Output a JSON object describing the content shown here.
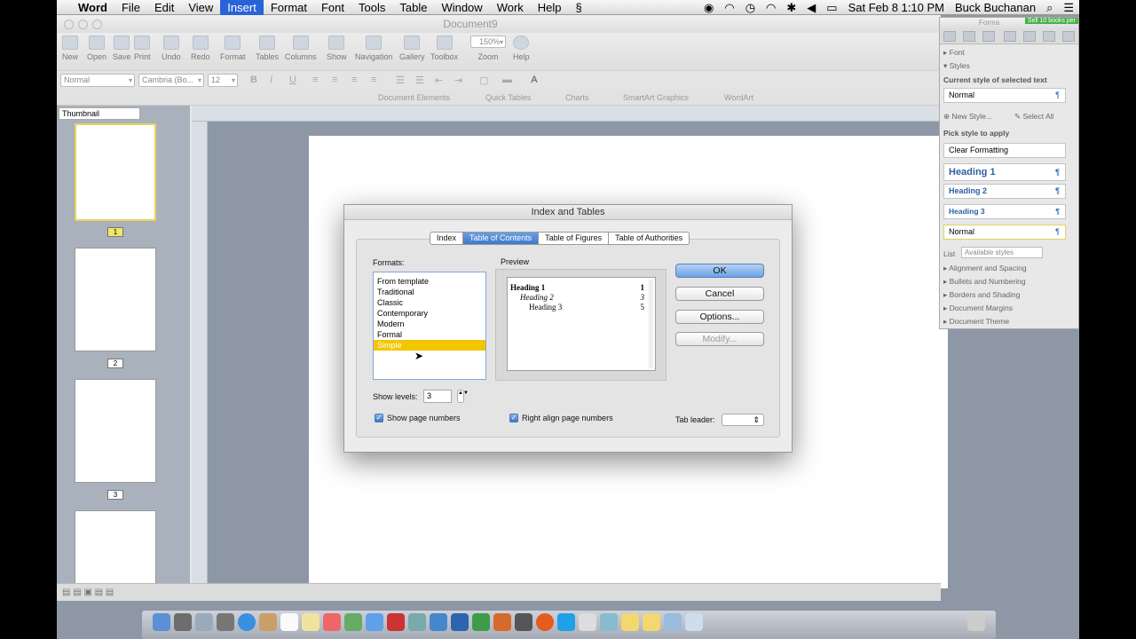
{
  "menubar": {
    "apple": "",
    "items": [
      "Word",
      "File",
      "Edit",
      "View",
      "Insert",
      "Format",
      "Font",
      "Tools",
      "Table",
      "Window",
      "Work",
      "Help"
    ],
    "status_icons": [
      "record-icon",
      "wifi-icon",
      "time-machine-icon",
      "airport-icon",
      "bluetooth-icon",
      "volume-icon",
      "battery-icon"
    ],
    "datetime": "Sat Feb 8  1:10 PM",
    "user": "Buck Buchanan",
    "search_icon": "spotlight-icon",
    "list_icon": "notification-list-icon"
  },
  "window": {
    "title": "Document9",
    "toolbar": [
      {
        "label": "New",
        "icon": "new-doc-icon"
      },
      {
        "label": "Open",
        "icon": "open-icon"
      },
      {
        "label": "Save",
        "icon": "save-icon"
      },
      {
        "label": "Print",
        "icon": "print-icon"
      },
      {
        "label": "Undo",
        "icon": "undo-icon"
      },
      {
        "label": "Redo",
        "icon": "redo-icon"
      },
      {
        "label": "Format",
        "icon": "format-brush-icon"
      },
      {
        "label": "Tables",
        "icon": "tables-icon"
      },
      {
        "label": "Columns",
        "icon": "columns-icon"
      },
      {
        "label": "Show",
        "icon": "pilcrow-icon"
      },
      {
        "label": "Navigation",
        "icon": "navigation-icon"
      },
      {
        "label": "Gallery",
        "icon": "gallery-icon"
      },
      {
        "label": "Toolbox",
        "icon": "toolbox-icon"
      },
      {
        "label": "Zoom",
        "icon": "zoom-icon"
      },
      {
        "label": "Help",
        "icon": "help-icon"
      }
    ],
    "zoom_value": "150%",
    "format_bar": {
      "style": "Normal",
      "font": "Cambria (Bo...",
      "size": "12",
      "bold": "B",
      "italic": "I",
      "underline": "U"
    },
    "ribbon_tabs": [
      "Document Elements",
      "Quick Tables",
      "Charts",
      "SmartArt Graphics",
      "WordArt"
    ],
    "sidebar": {
      "view": "Thumbnail",
      "pages": [
        "1",
        "2",
        "3"
      ]
    }
  },
  "dialog": {
    "title": "Index and Tables",
    "tabs": [
      "Index",
      "Table of Contents",
      "Table of Figures",
      "Table of Authorities"
    ],
    "active_tab": "Table of Contents",
    "formats_label": "Formats:",
    "formats": [
      "From template",
      "Traditional",
      "Classic",
      "Contemporary",
      "Modern",
      "Formal",
      "Simple"
    ],
    "selected_format": "Simple",
    "preview_label": "Preview",
    "preview": [
      {
        "text": "Heading 1",
        "page": "1"
      },
      {
        "text": "Heading 2",
        "page": "3"
      },
      {
        "text": "Heading 3",
        "page": "5"
      }
    ],
    "buttons": {
      "ok": "OK",
      "cancel": "Cancel",
      "options": "Options...",
      "modify": "Modify..."
    },
    "show_levels_label": "Show levels:",
    "show_levels_value": "3",
    "show_page_numbers": "Show page numbers",
    "right_align": "Right align page numbers",
    "tab_leader_label": "Tab leader:",
    "tab_leader_value": ""
  },
  "palette": {
    "title": "Forma",
    "badge": "Sell 10 books per",
    "font_section": "Font",
    "styles_section": "Styles",
    "current_label": "Current style of selected text",
    "current_style": "Normal",
    "new_style": "New Style...",
    "select_all": "Select All",
    "pick_label": "Pick style to apply",
    "styles": [
      "Clear Formatting",
      "Heading 1",
      "Heading 2",
      "Heading 3",
      "Normal"
    ],
    "list_label": "List",
    "list_value": "Available styles",
    "sections": [
      "Alignment and Spacing",
      "Bullets and Numbering",
      "Borders and Shading",
      "Document Margins",
      "Document Theme"
    ]
  },
  "colors": {
    "accent": "#3e78c8",
    "highlight": "#f2c600",
    "menu_selected": "#2a63d8"
  }
}
